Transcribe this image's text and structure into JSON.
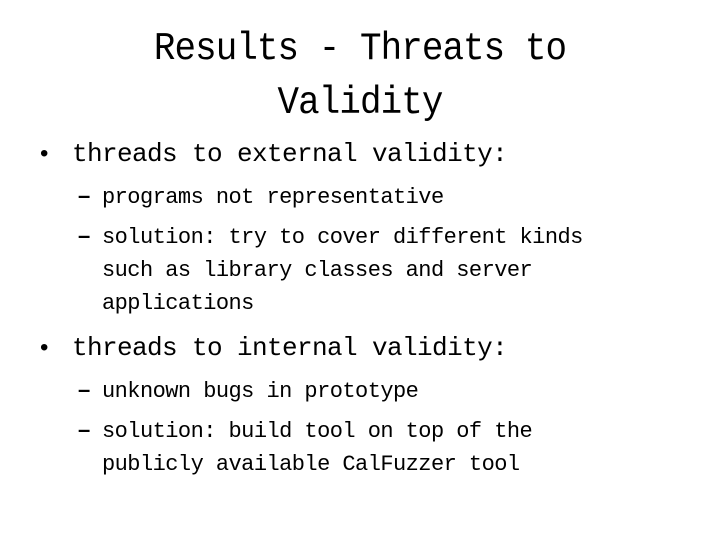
{
  "slide": {
    "title_lines": [
      "Results - Threats to",
      "Validity"
    ],
    "sections": [
      {
        "bullet": "threads to external validity:",
        "subitems": [
          {
            "lines": [
              "programs not representative"
            ]
          },
          {
            "lines": [
              "solution: try to cover different kinds",
              "such as library classes and server",
              "applications"
            ]
          }
        ]
      },
      {
        "bullet": "threads to internal validity:",
        "subitems": [
          {
            "lines": [
              "unknown bugs in prototype"
            ]
          },
          {
            "lines": [
              "solution: build tool on top of the",
              "publicly available CalFuzzer tool"
            ]
          }
        ]
      }
    ],
    "bullet_glyph": "•",
    "dash_glyph": "–"
  }
}
